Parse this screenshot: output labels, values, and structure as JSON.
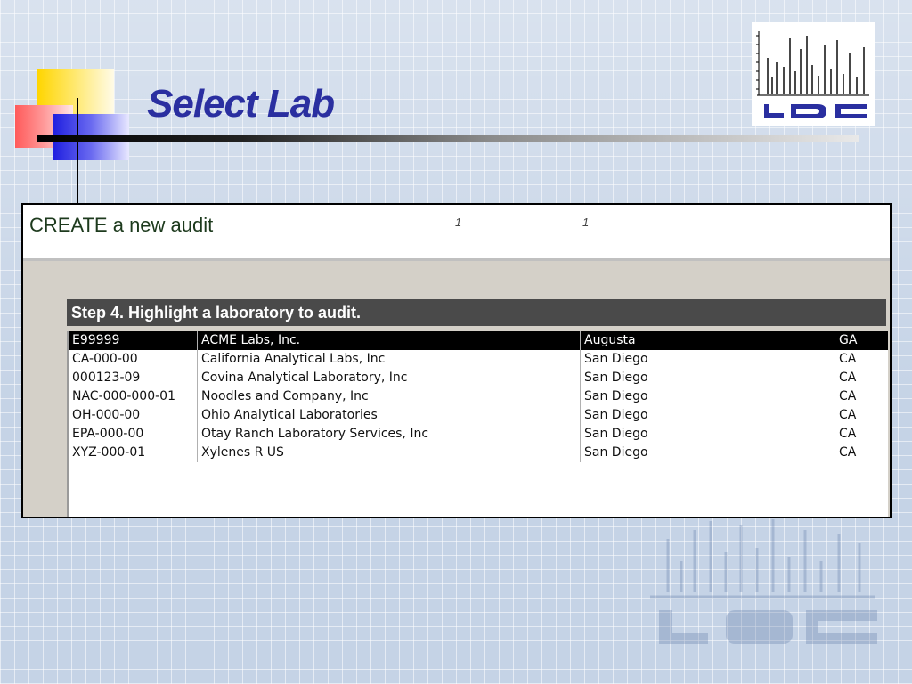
{
  "slide": {
    "title": "Select Lab",
    "logo_text": "LDC",
    "colors": {
      "title": "#2a2fa0",
      "background": "#c5d3e6"
    }
  },
  "app": {
    "header_text": "CREATE a new audit",
    "indicator_1": "1",
    "indicator_2": "1",
    "step_text": "Step 4.  Highlight a laboratory to audit.",
    "labs": [
      {
        "id": "E99999",
        "name": "ACME Labs, Inc.",
        "city": "Augusta",
        "state": "GA"
      },
      {
        "id": "CA-000-00",
        "name": "California Analytical Labs, Inc",
        "city": "San Diego",
        "state": "CA"
      },
      {
        "id": "000123-09",
        "name": "Covina Analytical Laboratory, Inc",
        "city": "San Diego",
        "state": "CA"
      },
      {
        "id": "NAC-000-000-01",
        "name": "Noodles and Company, Inc",
        "city": "San Diego",
        "state": "CA"
      },
      {
        "id": "OH-000-00",
        "name": "Ohio Analytical Laboratories",
        "city": "San Diego",
        "state": "CA"
      },
      {
        "id": "EPA-000-00",
        "name": "Otay Ranch Laboratory Services, Inc",
        "city": "San Diego",
        "state": "CA"
      },
      {
        "id": "XYZ-000-01",
        "name": "Xylenes R US",
        "city": "San Diego",
        "state": "CA"
      }
    ],
    "selected_index": 0
  }
}
